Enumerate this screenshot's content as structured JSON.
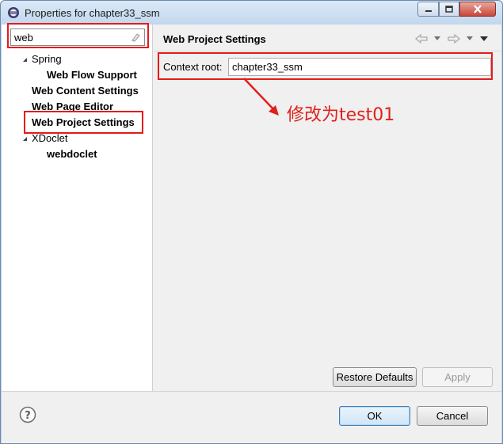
{
  "window": {
    "title": "Properties for chapter33_ssm"
  },
  "filter": {
    "value": "web"
  },
  "tree": {
    "items": [
      {
        "label": "Spring",
        "bold": false,
        "expander": true
      },
      {
        "label": "Web Flow Support",
        "bold": true,
        "expander": false
      },
      {
        "label": "Web Content Settings",
        "bold": true,
        "expander": false
      },
      {
        "label": "Web Page Editor",
        "bold": true,
        "expander": false
      },
      {
        "label": "Web Project Settings",
        "bold": true,
        "expander": false,
        "selected": true
      },
      {
        "label": "XDoclet",
        "bold": false,
        "expander": true
      },
      {
        "label": "webdoclet",
        "bold": true,
        "expander": false
      }
    ]
  },
  "page": {
    "title": "Web Project Settings",
    "context_root_label": "Context root:",
    "context_root_value": "chapter33_ssm"
  },
  "annotation": {
    "text": "修改为test01",
    "color": "#e0201a"
  },
  "buttons": {
    "restore_defaults": "Restore Defaults",
    "apply": "Apply",
    "ok": "OK",
    "cancel": "Cancel"
  },
  "colors": {
    "highlight": "#e51a1a"
  }
}
